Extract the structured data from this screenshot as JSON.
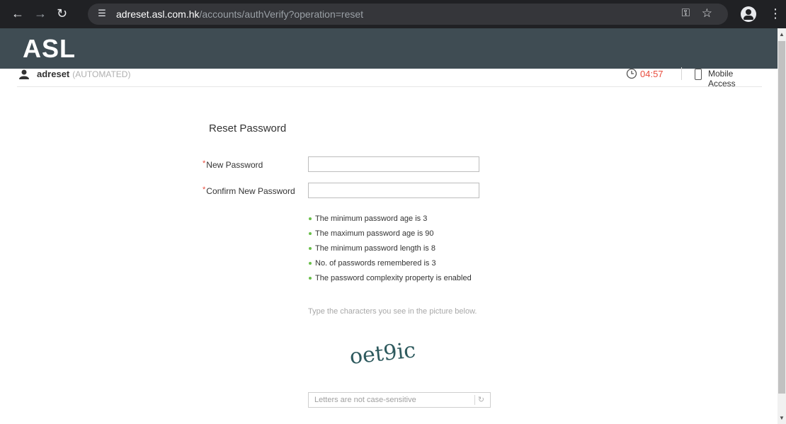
{
  "browser": {
    "url_host": "adreset.asl.com.hk",
    "url_path": "/accounts/authVerify?operation=reset"
  },
  "app": {
    "logo_text": "ASL"
  },
  "userbar": {
    "username": "adreset",
    "user_tag": "(AUTOMATED)",
    "timer": "04:57",
    "mobile_access": "Mobile Access"
  },
  "form": {
    "title": "Reset Password",
    "required_mark": "*",
    "new_password_label": "New Password",
    "confirm_password_label": "Confirm New Password",
    "new_password_value": "",
    "confirm_password_value": ""
  },
  "rules": [
    "The minimum password age is 3",
    "The maximum password age is 90",
    "The minimum password length is 8",
    "No. of passwords remembered is 3",
    "The password complexity property is enabled"
  ],
  "captcha": {
    "hint": "Type the characters you see in the picture below.",
    "image_text": "oet9ic",
    "placeholder": "Letters are not case-sensitive",
    "value": ""
  },
  "colors": {
    "app_header": "#3f4c53",
    "timer": "#e84c3d",
    "bullet": "#6abf4b",
    "captcha_text": "#2e5a5e"
  }
}
